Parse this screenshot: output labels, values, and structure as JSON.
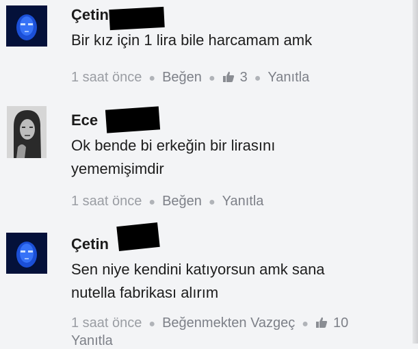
{
  "comments": [
    {
      "name": "Çetin",
      "text_lines": [
        "Bir kız için 1 lira bile harcamam amk"
      ],
      "time": "1 saat önce",
      "like_action": "Beğen",
      "like_count": "3",
      "reply": "Yanıtla",
      "avatar": "blue-face-avatar"
    },
    {
      "name": "Ece",
      "text_lines": [
        "Ok bende bi erkeğin bir lirasını",
        "yememişimdir"
      ],
      "time": "1 saat önce",
      "like_action": "Beğen",
      "reply": "Yanıtla",
      "avatar": "woman-portrait-avatar"
    },
    {
      "name": "Çetin",
      "text_lines": [
        "Sen niye kendini katıyorsun amk sana",
        "nutella fabrikası alırım"
      ],
      "time": "1 saat önce",
      "like_action": "Beğenmekten Vazgeç",
      "like_count": "10",
      "reply": "Yanıtla",
      "avatar": "blue-face-avatar"
    }
  ],
  "colors": {
    "background": "#f3f4f6",
    "text": "#1d1d1d",
    "meta": "#9a9da3",
    "redaction": "#000000"
  }
}
